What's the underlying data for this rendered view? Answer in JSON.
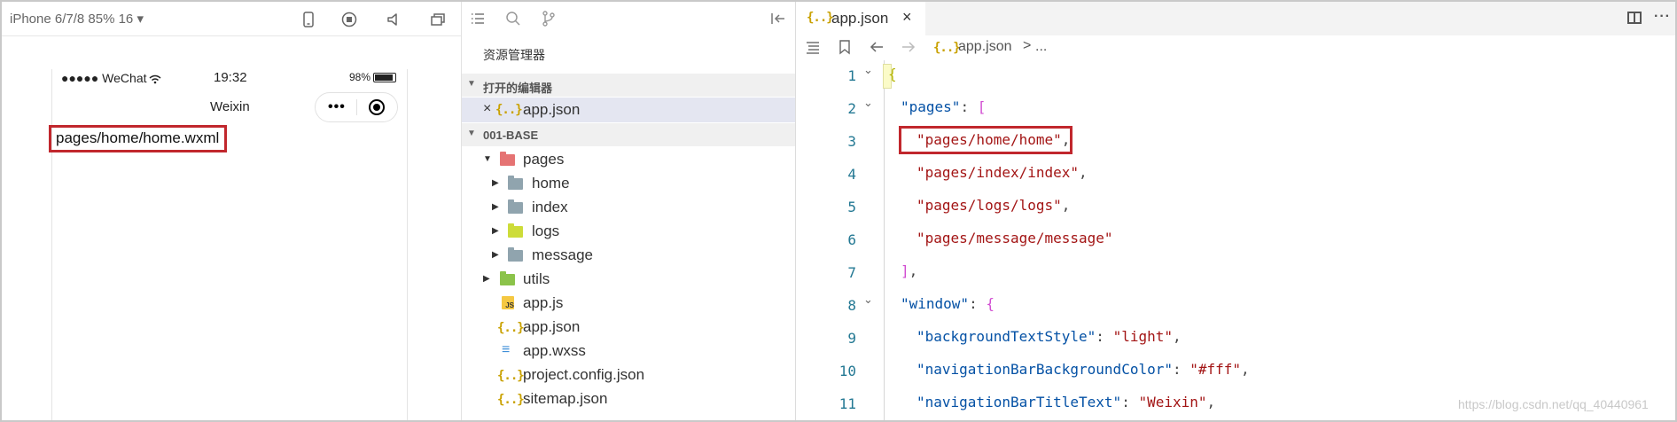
{
  "simulator": {
    "device_label": "iPhone 6/7/8 85% 16 ▾",
    "status_signal": "●●●●● WeChat",
    "status_time": "19:32",
    "status_battery": "98%",
    "nav_title": "Weixin",
    "page_text": "pages/home/home.wxml",
    "toolbar_icons": [
      "phone-icon",
      "record-icon",
      "volume-icon",
      "window-icon"
    ]
  },
  "explorer": {
    "title": "资源管理器",
    "open_editors_header": "打开的编辑器",
    "open_editor_file": "app.json",
    "project_header": "001-BASE",
    "tree": [
      {
        "label": "pages",
        "kind": "folder-red",
        "depth": 1,
        "expanded": true
      },
      {
        "label": "home",
        "kind": "folder",
        "depth": 2,
        "expanded": false
      },
      {
        "label": "index",
        "kind": "folder",
        "depth": 2,
        "expanded": false
      },
      {
        "label": "logs",
        "kind": "folder-yellow",
        "depth": 2,
        "expanded": false
      },
      {
        "label": "message",
        "kind": "folder",
        "depth": 2,
        "expanded": false
      },
      {
        "label": "utils",
        "kind": "folder-green",
        "depth": 1,
        "expanded": false
      },
      {
        "label": "app.js",
        "kind": "js",
        "depth": 1
      },
      {
        "label": "app.json",
        "kind": "json",
        "depth": 1
      },
      {
        "label": "app.wxss",
        "kind": "wxss",
        "depth": 1
      },
      {
        "label": "project.config.json",
        "kind": "json",
        "depth": 1
      },
      {
        "label": "sitemap.json",
        "kind": "json",
        "depth": 1
      }
    ]
  },
  "editor": {
    "tab_label": "app.json",
    "tab_icon": "{..}",
    "tab_close": "×",
    "breadcrumb_file": "app.json",
    "breadcrumb_sep": ">",
    "breadcrumb_more": "...",
    "line_numbers": [
      "1",
      "2",
      "3",
      "4",
      "5",
      "6",
      "7",
      "8",
      "9",
      "10",
      "11"
    ],
    "lines": {
      "l1": {
        "open": "{"
      },
      "l2": {
        "key": "\"pages\"",
        "colon": ": ",
        "open": "["
      },
      "l3": {
        "value": "\"pages/home/home\"",
        "comma": ","
      },
      "l4": {
        "value": "\"pages/index/index\"",
        "comma": ","
      },
      "l5": {
        "value": "\"pages/logs/logs\"",
        "comma": ","
      },
      "l6": {
        "value": "\"pages/message/message\""
      },
      "l7": {
        "close": "]",
        "comma": ","
      },
      "l8": {
        "key": "\"window\"",
        "colon": ": ",
        "open": "{"
      },
      "l9": {
        "key": "\"backgroundTextStyle\"",
        "colon": ": ",
        "value": "\"light\"",
        "comma": ","
      },
      "l10": {
        "key": "\"navigationBarBackgroundColor\"",
        "colon": ": ",
        "value": "\"#fff\"",
        "comma": ","
      },
      "l11": {
        "key": "\"navigationBarTitleText\"",
        "colon": ": ",
        "value": "\"Weixin\"",
        "comma": ","
      }
    }
  },
  "watermark": "https://blog.csdn.net/qq_40440961",
  "colors": {
    "highlight_box": "#c1272d",
    "json_key": "#0451a5",
    "json_string": "#a31515",
    "line_number": "#237893",
    "selected_row": "#e4e6f1"
  }
}
